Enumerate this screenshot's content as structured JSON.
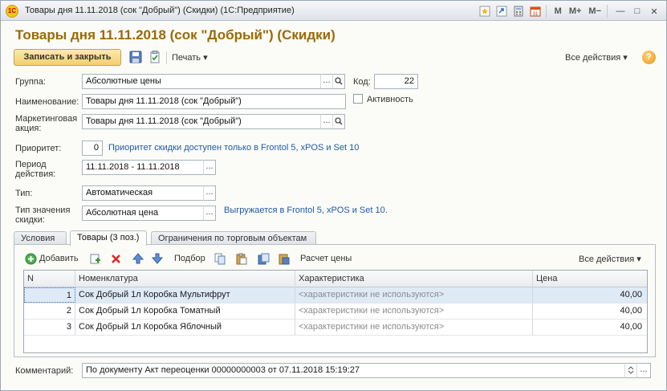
{
  "window": {
    "title": "Товары дня 11.11.2018 (сок \"Добрый\") (Скидки)  (1С:Предприятие)",
    "logo_text": "1С",
    "buttons": {
      "m": "M",
      "m_plus": "M+",
      "m_minus": "M−",
      "minimize": "—",
      "maximize": "□",
      "close": "✕"
    }
  },
  "form": {
    "title": "Товары дня 11.11.2018 (сок \"Добрый\") (Скидки)"
  },
  "toolbar": {
    "save_close": "Записать и закрыть",
    "print": "Печать ▾",
    "all_actions": "Все действия ▾",
    "help": "?"
  },
  "fields": {
    "group_label": "Группа:",
    "group_value": "Абсолютные цены",
    "code_label": "Код:",
    "code_value": "22",
    "name_label": "Наименование:",
    "name_value": "Товары дня 11.11.2018 (сок \"Добрый\")",
    "active_label": "Активность",
    "promo_label_1": "Маркетинговая",
    "promo_label_2": "акция:",
    "promo_value": "Товары дня 11.11.2018 (сок \"Добрый\")",
    "priority_label": "Приоритет:",
    "priority_value": "0",
    "priority_hint": "Приоритет скидки доступен только в Frontol 5, xPOS и Set 10",
    "period_label_1": "Период",
    "period_label_2": "действия:",
    "period_value": "11.11.2018 - 11.11.2018",
    "type_label": "Тип:",
    "type_value": "Автоматическая",
    "valuetype_label_1": "Тип значения",
    "valuetype_label_2": "скидки:",
    "valuetype_value": "Абсолютная цена",
    "valuetype_hint": "Выгружается в Frontol 5, xPOS и Set 10."
  },
  "tabs": [
    {
      "label": "Условия"
    },
    {
      "label": "Товары (3 поз.)"
    },
    {
      "label": "Ограничения по торговым объектам"
    }
  ],
  "table_toolbar": {
    "add": "Добавить",
    "select": "Подбор",
    "price_calc": "Расчет цены",
    "all_actions": "Все действия ▾"
  },
  "table": {
    "columns": [
      "N",
      "Номенклатура",
      "Характеристика",
      "Цена"
    ],
    "rows": [
      {
        "n": "1",
        "item": "Сок Добрый 1л Коробка Мультифрут",
        "char": "<характеристики не используются>",
        "price": "40,00"
      },
      {
        "n": "2",
        "item": "Сок Добрый 1л Коробка Томатный",
        "char": "<характеристики не используются>",
        "price": "40,00"
      },
      {
        "n": "3",
        "item": "Сок Добрый 1л Коробка Яблочный",
        "char": "<характеристики не используются>",
        "price": "40,00"
      }
    ]
  },
  "comment": {
    "label": "Комментарий:",
    "value": "По документу Акт переоценки 00000000003 от 07.11.2018 15:19:27"
  },
  "colors": {
    "title": "#9c6a00",
    "hint": "#1f5aa8",
    "primary_button": "#f2cf6d"
  }
}
